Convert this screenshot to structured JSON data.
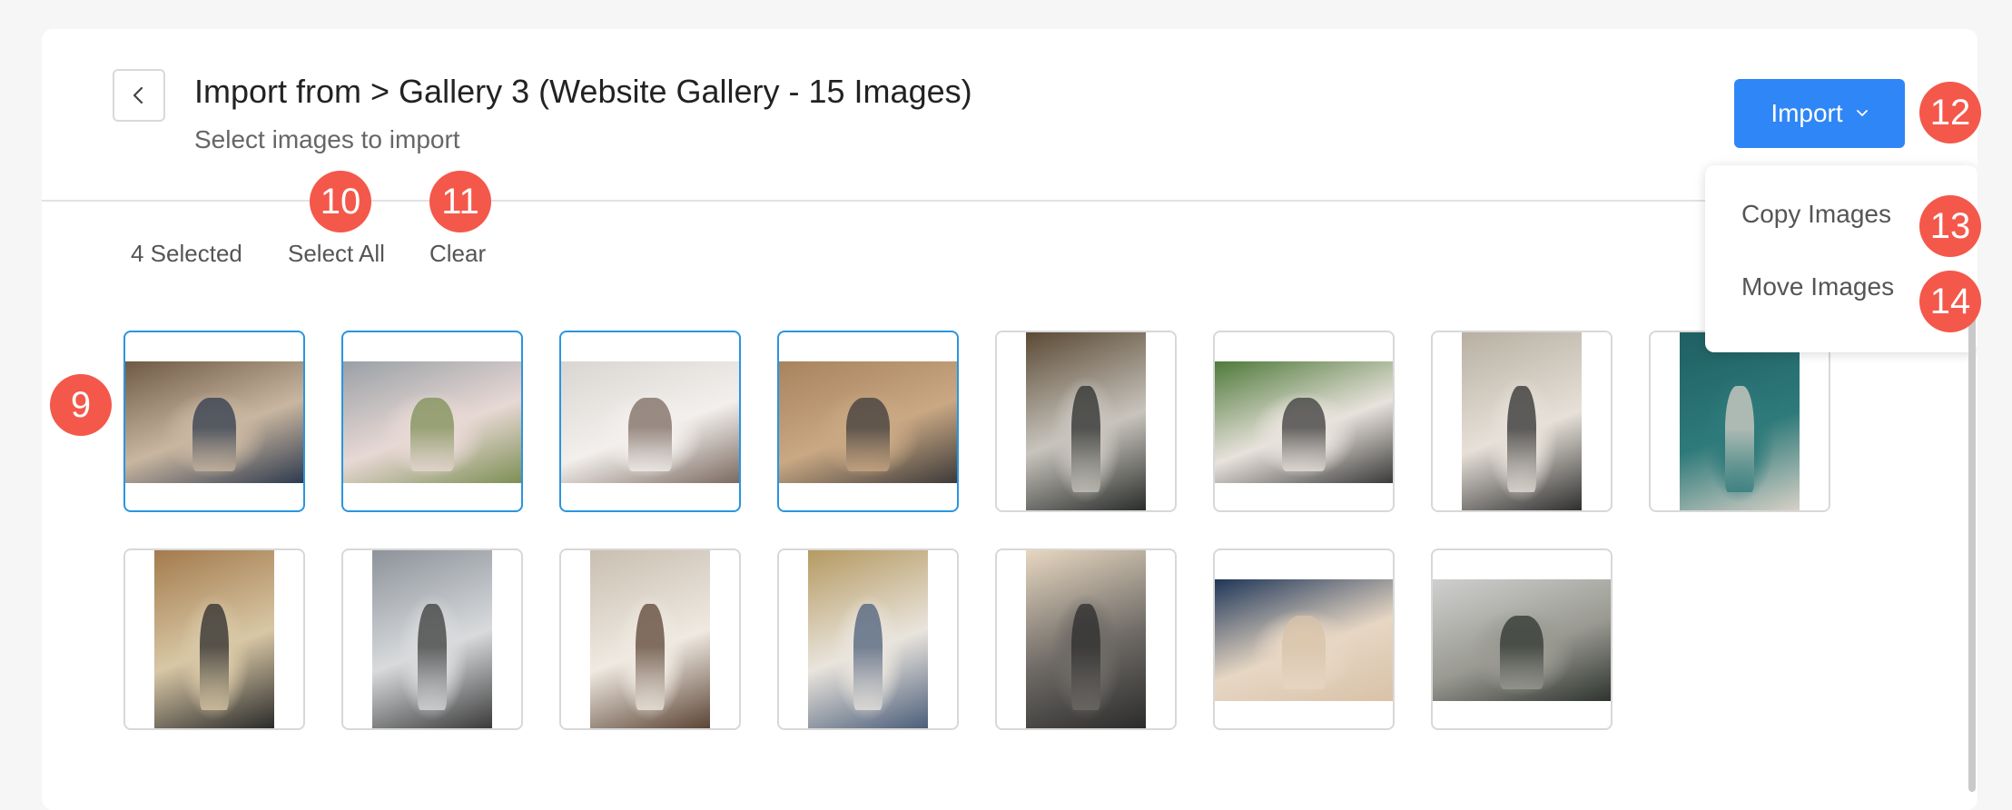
{
  "header": {
    "title": "Import from > Gallery 3 (Website Gallery - 15 Images)",
    "subtitle": "Select images to import",
    "import_label": "Import"
  },
  "dropdown": {
    "items": [
      {
        "label": "Copy Images"
      },
      {
        "label": "Move Images"
      }
    ]
  },
  "selection": {
    "count_label": "4 Selected",
    "select_all": "Select All",
    "clear": "Clear"
  },
  "badges": {
    "images_grid": "9",
    "select_all": "10",
    "clear": "11",
    "import": "12",
    "copy": "13",
    "move": "14"
  },
  "colors": {
    "accent": "#2f86f6",
    "selected_border": "#2a95e0",
    "badge": "#f4584a"
  },
  "images": [
    {
      "selected": true,
      "orientation": "landscape",
      "subject": "couple-smiling",
      "tone": [
        "#6e5a45",
        "#c9b6a0",
        "#2e3a4d"
      ]
    },
    {
      "selected": true,
      "orientation": "landscape",
      "subject": "bouquet-hands",
      "tone": [
        "#9aa0a6",
        "#e7d8d4",
        "#7d8f55"
      ]
    },
    {
      "selected": true,
      "orientation": "landscape",
      "subject": "veil-kiss",
      "tone": [
        "#d9d6d2",
        "#f2efec",
        "#7b6a60"
      ]
    },
    {
      "selected": true,
      "orientation": "landscape",
      "subject": "stone-wall-couple",
      "tone": [
        "#a8835e",
        "#c9a883",
        "#3d3a3a"
      ]
    },
    {
      "selected": false,
      "orientation": "portrait",
      "subject": "forest-veil",
      "tone": [
        "#5b4a35",
        "#c8c4bd",
        "#2a2d2b"
      ]
    },
    {
      "selected": false,
      "orientation": "landscape",
      "subject": "hands-on-dress",
      "tone": [
        "#4f7a3a",
        "#e8e2dc",
        "#3a3a3a"
      ]
    },
    {
      "selected": false,
      "orientation": "portrait",
      "subject": "couple-from-behind",
      "tone": [
        "#b7b0a2",
        "#e6e0d8",
        "#2f2f2f"
      ]
    },
    {
      "selected": false,
      "orientation": "portrait",
      "subject": "ocean-aerial",
      "tone": [
        "#1f5f63",
        "#2e7a7a",
        "#d7d0c6"
      ]
    },
    {
      "selected": false,
      "orientation": "portrait",
      "subject": "field-couple",
      "tone": [
        "#a47b4d",
        "#d8c7a5",
        "#2b2b2b"
      ]
    },
    {
      "selected": false,
      "orientation": "portrait",
      "subject": "beach-veil",
      "tone": [
        "#8d939a",
        "#d8dadc",
        "#3b3b3b"
      ]
    },
    {
      "selected": false,
      "orientation": "portrait",
      "subject": "bride-bouquet",
      "tone": [
        "#c9bfb1",
        "#efe9e1",
        "#5b4435"
      ]
    },
    {
      "selected": false,
      "orientation": "portrait",
      "subject": "meadow-veil",
      "tone": [
        "#b59a62",
        "#e9e4dc",
        "#4c5e7a"
      ]
    },
    {
      "selected": false,
      "orientation": "portrait",
      "subject": "rooftop-sunset",
      "tone": [
        "#e7d7c0",
        "#6e6a66",
        "#2c2c2c"
      ]
    },
    {
      "selected": false,
      "orientation": "landscape",
      "subject": "groom-boutonniere",
      "tone": [
        "#1f3658",
        "#e6d6c3",
        "#d8c2a8"
      ]
    },
    {
      "selected": false,
      "orientation": "landscape",
      "subject": "hill-couple",
      "tone": [
        "#cfcfcf",
        "#9a9a92",
        "#2f342f"
      ]
    }
  ]
}
